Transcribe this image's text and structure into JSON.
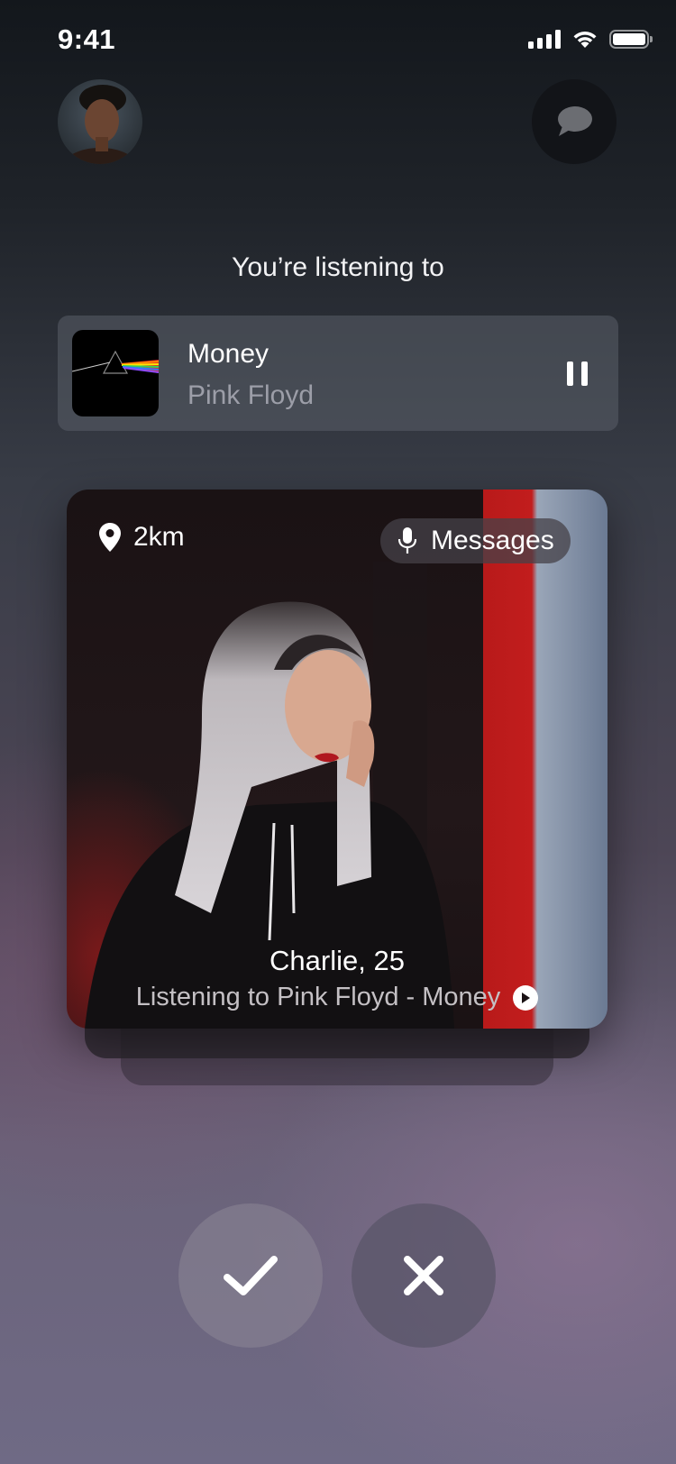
{
  "status_bar": {
    "time": "9:41"
  },
  "header": {
    "avatar": "user-avatar",
    "chat_icon": "chat-bubble-icon"
  },
  "now_playing": {
    "label": "You’re listening to",
    "title": "Money",
    "artist": "Pink Floyd",
    "state": "playing"
  },
  "profile_card": {
    "distance": "2km",
    "voice_chip_label": "Messages",
    "name_age": "Charlie, 25",
    "listening": "Listening to Pink Floyd - Money"
  },
  "actions": {
    "accept_icon": "checkmark-icon",
    "reject_icon": "close-icon"
  },
  "colors": {
    "background_top": "#13171c",
    "background_bottom": "#6f6a85",
    "card_red": "#c21d1d"
  }
}
